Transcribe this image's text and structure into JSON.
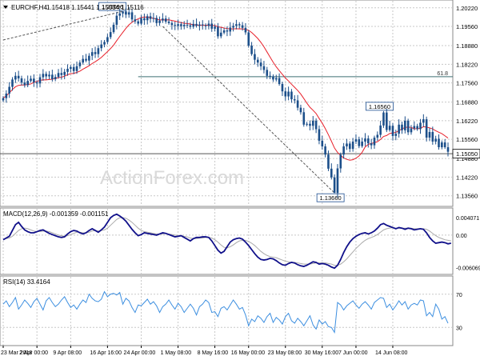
{
  "chart_data": {
    "type": "candlestick",
    "symbol_header": "EURCHF,H4",
    "ohlc_header": "1.15418 1.15441 1.15034 1.15116",
    "watermark": "ActionForex.com",
    "colors": {
      "candle": "#1c4f8a",
      "ma": "#e8202a",
      "macd_main": "#10108a",
      "macd_signal": "#aaaaaa",
      "rsi": "#3d8fe0",
      "fib_line": "#3e6f73",
      "current_line": "#555555",
      "trend_line": "#555555",
      "grid": "#c8c8c8"
    },
    "price": {
      "ylim": [
        1.1324,
        1.2044
      ],
      "ticks": [
        "1.20220",
        "1.19560",
        "1.18880",
        "1.18220",
        "1.17560",
        "1.16880",
        "1.16220",
        "1.15560",
        "1.14880",
        "1.14220",
        "1.13560"
      ],
      "tick_values": [
        1.2022,
        1.1956,
        1.1888,
        1.1822,
        1.1756,
        1.1688,
        1.1622,
        1.1556,
        1.1488,
        1.1422,
        1.1356
      ],
      "current_price": 1.1505,
      "current_label": "1.15050",
      "fib": {
        "value": 1.1778,
        "label": "61.8"
      },
      "annotations": [
        {
          "text": "1.20096",
          "value": 1.20096,
          "bar": 39
        },
        {
          "text": "1.16560",
          "value": 1.1656,
          "bar": 124
        },
        {
          "text": "1.13660",
          "value": 1.1366,
          "bar": 108
        }
      ],
      "trend_line_1": [
        [
          0,
          1.1908
        ],
        [
          39,
          1.20096
        ]
      ],
      "trend_line_2": [
        [
          52,
          1.1956
        ],
        [
          108,
          1.1366
        ]
      ],
      "fib_start_bar": 44,
      "closes": [
        1.1702,
        1.1718,
        1.1742,
        1.1768,
        1.1781,
        1.1772,
        1.1757,
        1.1748,
        1.1763,
        1.1771,
        1.1758,
        1.1754,
        1.1776,
        1.1788,
        1.1779,
        1.1785,
        1.1769,
        1.1777,
        1.1791,
        1.1784,
        1.1795,
        1.1806,
        1.1812,
        1.1798,
        1.1815,
        1.1828,
        1.1841,
        1.1835,
        1.1852,
        1.1865,
        1.1858,
        1.1879,
        1.1892,
        1.1901,
        1.1918,
        1.1936,
        1.1962,
        1.1994,
        1.2002,
        1.2009,
        1.1998,
        1.2006,
        1.1981,
        1.1974,
        1.1966,
        1.1985,
        1.1978,
        1.1992,
        1.1983,
        1.1986,
        1.1968,
        1.1977,
        1.1984,
        1.1973,
        1.1968,
        1.1961,
        1.1958,
        1.1964,
        1.1957,
        1.1962,
        1.196,
        1.1955,
        1.1965,
        1.1958,
        1.1963,
        1.196,
        1.1958,
        1.1966,
        1.1948,
        1.1955,
        1.1921,
        1.1934,
        1.1942,
        1.1938,
        1.1952,
        1.1958,
        1.1964,
        1.196,
        1.1951,
        1.1935,
        1.1888,
        1.1858,
        1.1838,
        1.1828,
        1.1815,
        1.1802,
        1.1781,
        1.1779,
        1.1768,
        1.1773,
        1.1752,
        1.1726,
        1.1708,
        1.1725,
        1.1698,
        1.1694,
        1.1668,
        1.1652,
        1.1608,
        1.1611,
        1.1604,
        1.1622,
        1.1592,
        1.1551,
        1.1531,
        1.1502,
        1.1452,
        1.1421,
        1.1366,
        1.1453,
        1.1502,
        1.1531,
        1.1541,
        1.1522,
        1.1548,
        1.1556,
        1.1532,
        1.1548,
        1.1559,
        1.1542,
        1.1535,
        1.1562,
        1.1572,
        1.1605,
        1.1651,
        1.1589,
        1.1604,
        1.1568,
        1.1576,
        1.1608,
        1.1588,
        1.1622,
        1.1581,
        1.1595,
        1.1603,
        1.1592,
        1.1615,
        1.1627,
        1.1562,
        1.1582,
        1.1548,
        1.1558,
        1.1528,
        1.1545,
        1.1528,
        1.1512
      ]
    },
    "macd": {
      "label": "MACD(12,26,9) -0.001359 -0.001151",
      "ylim": [
        -0.0065,
        0.0044
      ],
      "ticks": [
        "0.004071",
        "0.00",
        "-0.006069"
      ],
      "tick_values": [
        0.003,
        0.0,
        -0.0056
      ],
      "main": [
        -0.0008,
        -0.0005,
        -0.0002,
        0.0008,
        0.0018,
        0.0022,
        0.0015,
        0.0009,
        0.0006,
        0.0004,
        0.0004,
        0.0006,
        0.0008,
        0.0009,
        0.0006,
        0.0003,
        0.0001,
        -0.0001,
        -0.0003,
        -0.0004,
        -0.0003,
        0.0002,
        0.0006,
        0.0008,
        0.0007,
        0.0004,
        0.0002,
        0.0004,
        0.0008,
        0.0011,
        0.0008,
        0.0005,
        0.0009,
        0.0014,
        0.0022,
        0.003,
        0.0034,
        0.0036,
        0.0033,
        0.0029,
        0.0024,
        0.0017,
        0.001,
        0.0004,
        -0.0001,
        0.0001,
        0.0004,
        0.0003,
        0.0002,
        0.0001,
        0.0,
        0.0002,
        0.0004,
        0.0003,
        0.0001,
        -0.0001,
        -0.0003,
        -0.0002,
        -0.0001,
        -0.0004,
        -0.0007,
        -0.001,
        -0.0006,
        -0.0004,
        -0.0004,
        -0.0003,
        -0.0003,
        -0.0004,
        -0.001,
        -0.0018,
        -0.0026,
        -0.0031,
        -0.0028,
        -0.002,
        -0.0012,
        -0.0008,
        -0.0006,
        -0.0005,
        -0.0007,
        -0.0012,
        -0.0018,
        -0.0025,
        -0.0032,
        -0.0038,
        -0.0042,
        -0.0043,
        -0.0042,
        -0.004,
        -0.0041,
        -0.0044,
        -0.0048,
        -0.0051,
        -0.0052,
        -0.0049,
        -0.0047,
        -0.0048,
        -0.0051,
        -0.0053,
        -0.0054,
        -0.0052,
        -0.0049,
        -0.0046,
        -0.0047,
        -0.005,
        -0.0049,
        -0.005,
        -0.0052,
        -0.0055,
        -0.0057,
        -0.0052,
        -0.0042,
        -0.003,
        -0.002,
        -0.0012,
        -0.0006,
        -0.0002,
        0.0001,
        0.0003,
        0.0004,
        0.0002,
        0.0004,
        0.0007,
        0.0012,
        0.0018,
        0.002,
        0.0017,
        0.0015,
        0.0013,
        0.0011,
        0.0013,
        0.0012,
        0.001,
        0.0012,
        0.0011,
        0.0009,
        0.001,
        0.0011,
        0.001,
        0.0004,
        -0.0004,
        -0.001,
        -0.0014,
        -0.0013,
        -0.0012,
        -0.0013,
        -0.0015,
        -0.0014
      ],
      "signal": [
        -0.0007,
        -0.0006,
        -0.0005,
        -0.0002,
        0.0003,
        0.0008,
        0.0011,
        0.0012,
        0.0011,
        0.0009,
        0.0007,
        0.0006,
        0.0006,
        0.0007,
        0.0007,
        0.0006,
        0.0004,
        0.0002,
        0.0,
        -0.0001,
        -0.0002,
        -0.0001,
        0.0001,
        0.0003,
        0.0005,
        0.0005,
        0.0004,
        0.0004,
        0.0005,
        0.0007,
        0.0008,
        0.0007,
        0.0008,
        0.0009,
        0.0012,
        0.0017,
        0.0022,
        0.0027,
        0.003,
        0.003,
        0.0029,
        0.0026,
        0.0022,
        0.0017,
        0.0012,
        0.0008,
        0.0006,
        0.0005,
        0.0004,
        0.0003,
        0.0002,
        0.0002,
        0.0002,
        0.0003,
        0.0002,
        0.0001,
        0.0,
        -0.0001,
        -0.0001,
        -0.0002,
        -0.0003,
        -0.0005,
        -0.0006,
        -0.0006,
        -0.0005,
        -0.0005,
        -0.0004,
        -0.0004,
        -0.0005,
        -0.0008,
        -0.0012,
        -0.0017,
        -0.0021,
        -0.0022,
        -0.002,
        -0.0017,
        -0.0013,
        -0.001,
        -0.0009,
        -0.0009,
        -0.0011,
        -0.0014,
        -0.0018,
        -0.0023,
        -0.0028,
        -0.0032,
        -0.0035,
        -0.0037,
        -0.0038,
        -0.0039,
        -0.0041,
        -0.0043,
        -0.0045,
        -0.0046,
        -0.0047,
        -0.0047,
        -0.0048,
        -0.0049,
        -0.005,
        -0.005,
        -0.005,
        -0.0049,
        -0.0048,
        -0.0048,
        -0.0048,
        -0.0048,
        -0.0049,
        -0.005,
        -0.0052,
        -0.0052,
        -0.005,
        -0.0046,
        -0.0041,
        -0.0035,
        -0.0029,
        -0.0023,
        -0.0018,
        -0.0013,
        -0.0009,
        -0.0006,
        -0.0004,
        -0.0002,
        0.0001,
        0.0005,
        0.0009,
        0.0011,
        0.0012,
        0.0013,
        0.0012,
        0.0012,
        0.0012,
        0.0012,
        0.0012,
        0.0012,
        0.0011,
        0.0011,
        0.0011,
        0.0011,
        0.001,
        0.0007,
        0.0003,
        -0.0001,
        -0.0004,
        -0.0006,
        -0.0008,
        -0.0009,
        -0.001
      ]
    },
    "rsi": {
      "label": "RSI(14) 33.4164",
      "ylim": [
        10,
        90
      ],
      "levels": [
        70,
        30
      ],
      "ticks": [
        "70",
        "30"
      ],
      "values": [
        58,
        62,
        55,
        60,
        66,
        52,
        57,
        63,
        59,
        54,
        61,
        65,
        58,
        51,
        62,
        66,
        60,
        55,
        58,
        63,
        67,
        60,
        54,
        57,
        52,
        58,
        63,
        60,
        70,
        65,
        62,
        61,
        64,
        73,
        67,
        70,
        71,
        69,
        72,
        58,
        65,
        62,
        54,
        48,
        57,
        56,
        60,
        64,
        58,
        61,
        56,
        48,
        55,
        58,
        63,
        57,
        52,
        59,
        55,
        48,
        53,
        58,
        53,
        45,
        55,
        58,
        63,
        60,
        48,
        49,
        43,
        53,
        55,
        51,
        57,
        63,
        58,
        52,
        54,
        45,
        32,
        40,
        37,
        44,
        41,
        36,
        43,
        47,
        36,
        42,
        39,
        34,
        43,
        47,
        38,
        35,
        41,
        37,
        32,
        38,
        44,
        33,
        28,
        39,
        34,
        37,
        31,
        30,
        24,
        60,
        57,
        51,
        56,
        59,
        62,
        57,
        53,
        58,
        61,
        57,
        52,
        60,
        63,
        66,
        65,
        54,
        58,
        51,
        56,
        62,
        57,
        61,
        52,
        57,
        59,
        57,
        63,
        62,
        44,
        48,
        43,
        58,
        52,
        40,
        43,
        35
      ]
    },
    "x_ticks": [
      {
        "bar": 0,
        "label": "23 Mar 2018"
      },
      {
        "bar": 11,
        "label": "2 Apr 00:00"
      },
      {
        "bar": 22,
        "label": "9 Apr 08:00"
      },
      {
        "bar": 34,
        "label": "16 Apr 16:00"
      },
      {
        "bar": 45,
        "label": "24 Apr 00:00"
      },
      {
        "bar": 57,
        "label": "1 May 08:00"
      },
      {
        "bar": 69,
        "label": "8 May 16:00"
      },
      {
        "bar": 80,
        "label": "16 May 00:00"
      },
      {
        "bar": 92,
        "label": "23 May 08:00"
      },
      {
        "bar": 104,
        "label": "30 May 16:00"
      },
      {
        "bar": 115,
        "label": "7 Jun 00:00"
      },
      {
        "bar": 127,
        "label": "14 Jun 08:00"
      }
    ]
  }
}
